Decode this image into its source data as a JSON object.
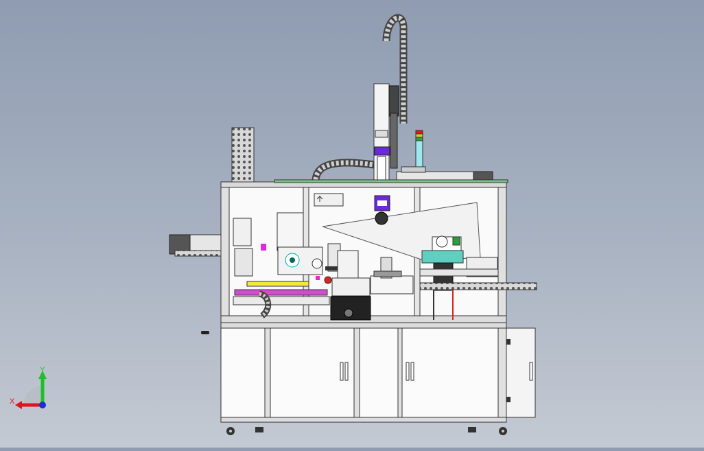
{
  "view": {
    "background_top": "#8f9cb1",
    "background_bottom": "#c4cad3"
  },
  "triad": {
    "x_label": "X",
    "y_label": "Y",
    "x_color": "#e0141e",
    "y_color": "#1fbf2a",
    "z_color": "#1830d0"
  },
  "machine": {
    "stack_light_colors": [
      "#e01a1a",
      "#e8c51c",
      "#2fa33b"
    ],
    "accent_colors": {
      "purple": "#6a2bd6",
      "magenta": "#e02ad8",
      "yellow": "#f2e83a",
      "red": "#e02020",
      "teal": "#5fd0c0",
      "cyan": "#9fe7ef",
      "green_part": "#23a23a"
    }
  }
}
